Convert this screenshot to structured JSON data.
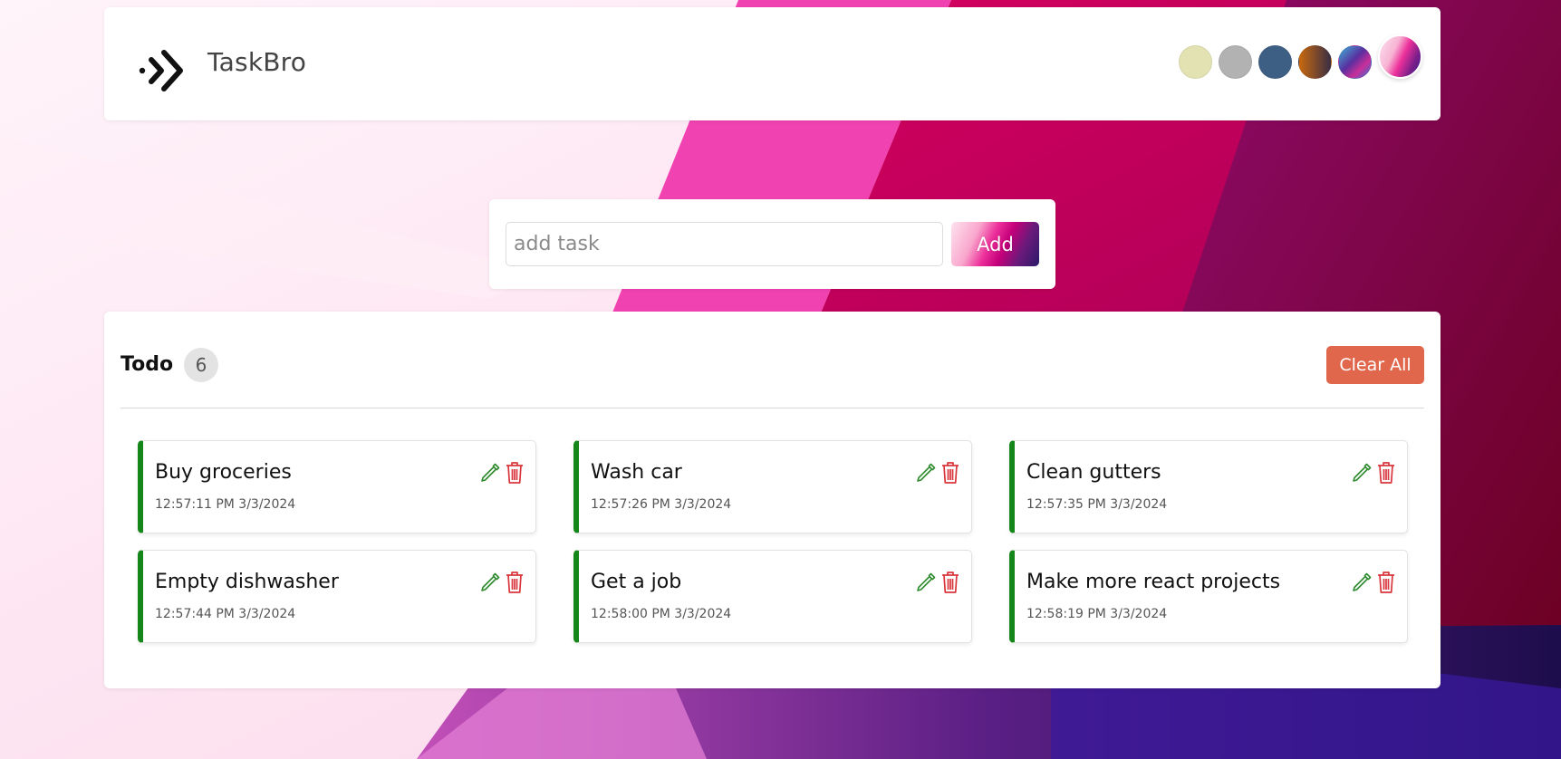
{
  "app": {
    "brand": "TaskBro",
    "logo_icon": "double-chevron-right-icon"
  },
  "themes": [
    {
      "name": "theme-cream",
      "color": "#e2e2b3"
    },
    {
      "name": "theme-gray",
      "color": "#b2b2b2"
    },
    {
      "name": "theme-slate-blue",
      "color": "#3e5f84"
    },
    {
      "name": "theme-orange",
      "color": "#c97116"
    },
    {
      "name": "theme-colorful",
      "color": "#6b3fa0"
    },
    {
      "name": "theme-pink-gradient",
      "color": "#e82f8c",
      "active": true
    }
  ],
  "add_task": {
    "placeholder": "add task",
    "value": "",
    "button_label": "Add"
  },
  "todo": {
    "title": "Todo",
    "count": "6",
    "clear_label": "Clear All",
    "accent_color": "#15861a",
    "edit_icon_color": "#2e8b2e",
    "delete_icon_color": "#d9353c",
    "tasks": [
      {
        "text": "Buy groceries",
        "time": "12:57:11 PM 3/3/2024"
      },
      {
        "text": "Wash car",
        "time": "12:57:26 PM 3/3/2024"
      },
      {
        "text": "Clean gutters",
        "time": "12:57:35 PM 3/3/2024"
      },
      {
        "text": "Empty dishwasher",
        "time": "12:57:44 PM 3/3/2024"
      },
      {
        "text": "Get a job",
        "time": "12:58:00 PM 3/3/2024"
      },
      {
        "text": "Make more react projects",
        "time": "12:58:19 PM 3/3/2024"
      }
    ]
  },
  "colors": {
    "clear_button": "#e0674c",
    "background_primary": "#e82f8c"
  }
}
